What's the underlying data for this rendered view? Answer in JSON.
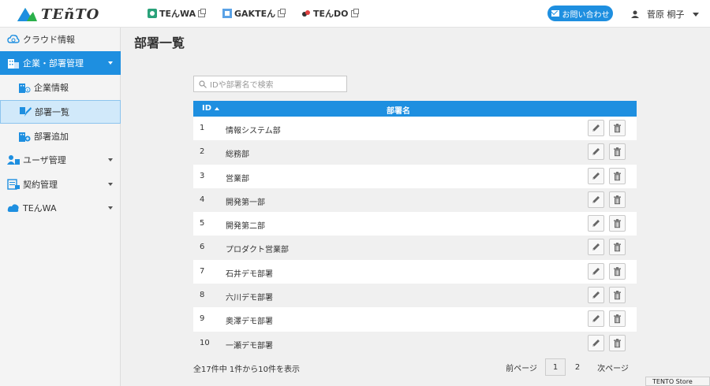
{
  "header": {
    "logo_text": "TEñTO",
    "services": [
      {
        "label": "TEんWA"
      },
      {
        "label": "GAKTEん"
      },
      {
        "label": "TEんDO"
      }
    ],
    "contact_label": "お問い合わせ",
    "user_name": "菅原 桐子"
  },
  "sidebar": {
    "items": [
      {
        "label": "クラウド情報"
      },
      {
        "label": "企業・部署管理"
      },
      {
        "label": "企業情報"
      },
      {
        "label": "部署一覧"
      },
      {
        "label": "部署追加"
      },
      {
        "label": "ユーザ管理"
      },
      {
        "label": "契約管理"
      },
      {
        "label": "TEんWA"
      }
    ]
  },
  "main": {
    "title": "部署一覧",
    "search_placeholder": "IDや部署名で検索",
    "table": {
      "headers": {
        "id": "ID",
        "name": "部署名"
      },
      "rows": [
        {
          "id": "1",
          "name": "情報システム部"
        },
        {
          "id": "2",
          "name": "総務部"
        },
        {
          "id": "3",
          "name": "営業部"
        },
        {
          "id": "4",
          "name": "開発第一部"
        },
        {
          "id": "5",
          "name": "開発第二部"
        },
        {
          "id": "6",
          "name": "プロダクト営業部"
        },
        {
          "id": "7",
          "name": "石井デモ部署"
        },
        {
          "id": "8",
          "name": "六川デモ部署"
        },
        {
          "id": "9",
          "name": "奥澤デモ部署"
        },
        {
          "id": "10",
          "name": "一瀬デモ部署"
        }
      ]
    },
    "footer_count": "全17件中 1件から10件を表示",
    "pagination": {
      "prev": "前ページ",
      "page1": "1",
      "page2": "2",
      "next": "次ページ"
    }
  },
  "store_badge": "TENTO Store"
}
